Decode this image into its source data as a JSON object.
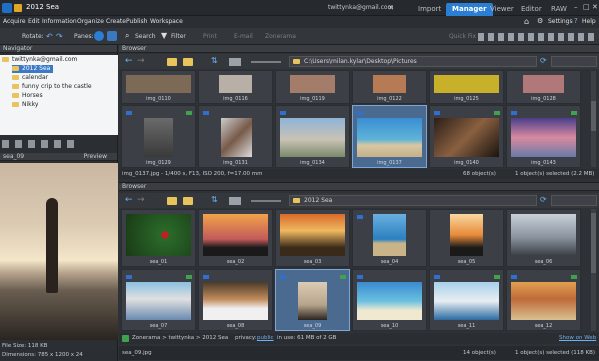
{
  "window": {
    "title": "2012 Sea",
    "user": "twittynka@gmail.com"
  },
  "tabs": [
    "Import",
    "Manager",
    "Viewer",
    "Editor",
    "RAW"
  ],
  "active_tab": "Manager",
  "menu": [
    "Acquire",
    "Edit",
    "Information",
    "Organize",
    "Create",
    "Publish",
    "Workspace"
  ],
  "menu_right": {
    "settings": "Settings",
    "help": "Help"
  },
  "toolbar": {
    "rotate": "Rotate:",
    "panes": "Panes:",
    "search": "Search",
    "filter": "Filter",
    "print": "Print",
    "email": "E-mail",
    "zonerama": "Zonerama",
    "quickfix": "Quick Fix"
  },
  "navigator": {
    "title": "Navigator",
    "root": "twittynka@gmail.com",
    "items": [
      "2012 Sea",
      "calendar",
      "funny crip to the castle",
      "Horses",
      "Nikky"
    ]
  },
  "preview": {
    "left_label": "sea_09",
    "right_label": "Preview",
    "file_size": "File Size: 118 KB",
    "dimensions": "Dimensions: 785 x 1200 x 24"
  },
  "browser1": {
    "title": "Browser",
    "path": "C:\\Users\\milan.kylar\\Desktop\\Pictures",
    "row1": [
      "img_0110",
      "img_0116",
      "img_0119",
      "img_0122",
      "img_0125",
      "img_0128"
    ],
    "row2": [
      "img_0129",
      "img_0131",
      "img_0134",
      "img_0137",
      "img_0140",
      "img_0143"
    ],
    "status_left": "img_0137.jpg - 1/400 s, F13, ISO 200, f=17.00 mm",
    "status_mid": "68 object(s)",
    "status_right": "1 object(s) selected (2.2 MB)"
  },
  "browser2": {
    "title": "Browser",
    "path": "2012 Sea",
    "row1": [
      "sea_01",
      "sea_02",
      "sea_03",
      "sea_04",
      "sea_05",
      "sea_06"
    ],
    "row2": [
      "sea_07",
      "sea_08",
      "sea_09",
      "sea_10",
      "sea_11",
      "sea_12"
    ],
    "breadcrumb": "Zonerama > twittynka > 2012 Sea",
    "privacy_label": "privacy:",
    "privacy_value": "public",
    "usage": "in use: 61 MB of 2 GB",
    "show_on_web": "Show on Web",
    "status_left": "sea_09.jpg",
    "status_mid": "14 object(s)",
    "status_right": "1 object(s) selected (118 KB)"
  },
  "colors": {
    "accent": "#2a7fd4",
    "bg": "#2e3135",
    "folder": "#e9c35b"
  }
}
